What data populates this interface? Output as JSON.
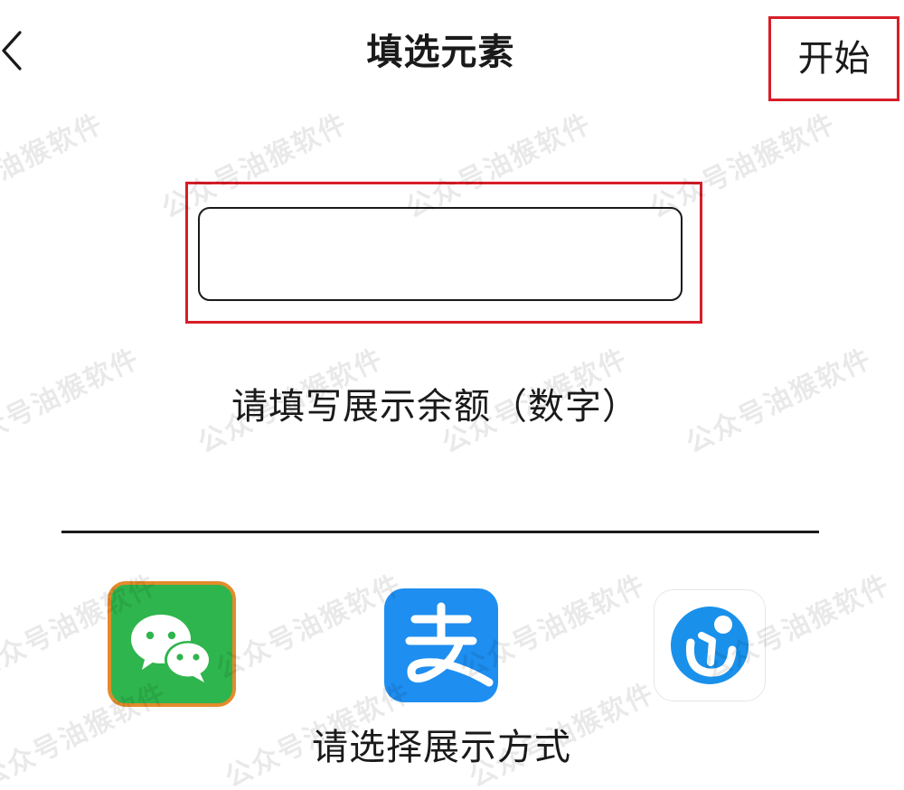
{
  "header": {
    "title": "填选元素",
    "start_label": "开始"
  },
  "balance": {
    "value": "",
    "placeholder": "",
    "instruction": "请填写展示余额（数字）"
  },
  "payment": {
    "options": [
      {
        "name": "wechat",
        "selected": true
      },
      {
        "name": "alipay",
        "selected": false
      },
      {
        "name": "other-app",
        "selected": false
      }
    ],
    "choose_label": "请选择展示方式"
  },
  "watermark_text": "公众号油猴软件",
  "colors": {
    "highlight_border": "#d81e28",
    "wechat_green": "#2fb54d",
    "wechat_selected_border": "#e38b2c",
    "alipay_blue": "#1e8ef0",
    "third_app_blue": "#1991ea",
    "text": "#1a1a1a"
  }
}
